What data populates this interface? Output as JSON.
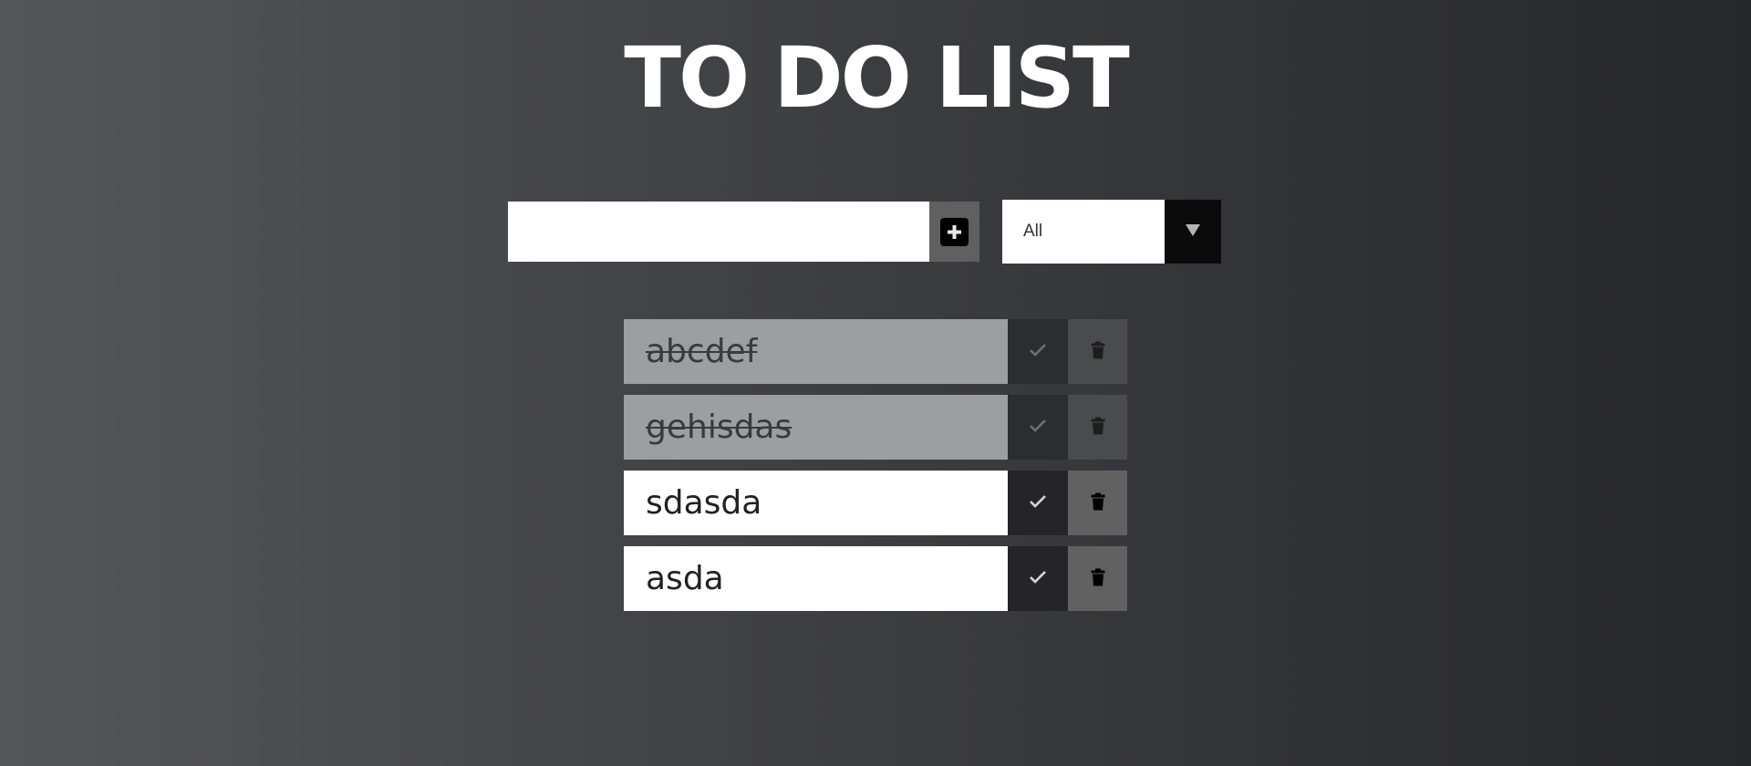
{
  "header": {
    "title": "TO DO LIST"
  },
  "form": {
    "task_input_value": "",
    "task_input_placeholder": "",
    "add_icon": "plus-icon",
    "filter_selected": "All",
    "filter_arrow_icon": "triangle-down-icon"
  },
  "todos": [
    {
      "text": "abcdef",
      "completed": true
    },
    {
      "text": "gehisdas",
      "completed": true
    },
    {
      "text": "sdasda",
      "completed": false
    },
    {
      "text": "asda",
      "completed": false
    }
  ],
  "icons": {
    "complete": "check-icon",
    "delete": "trash-icon"
  },
  "colors": {
    "background_left": "#55565a",
    "background_right": "#26272a",
    "completed_item": "#9d9ea0",
    "check_button": "#252527",
    "trash_button": "#616161"
  }
}
